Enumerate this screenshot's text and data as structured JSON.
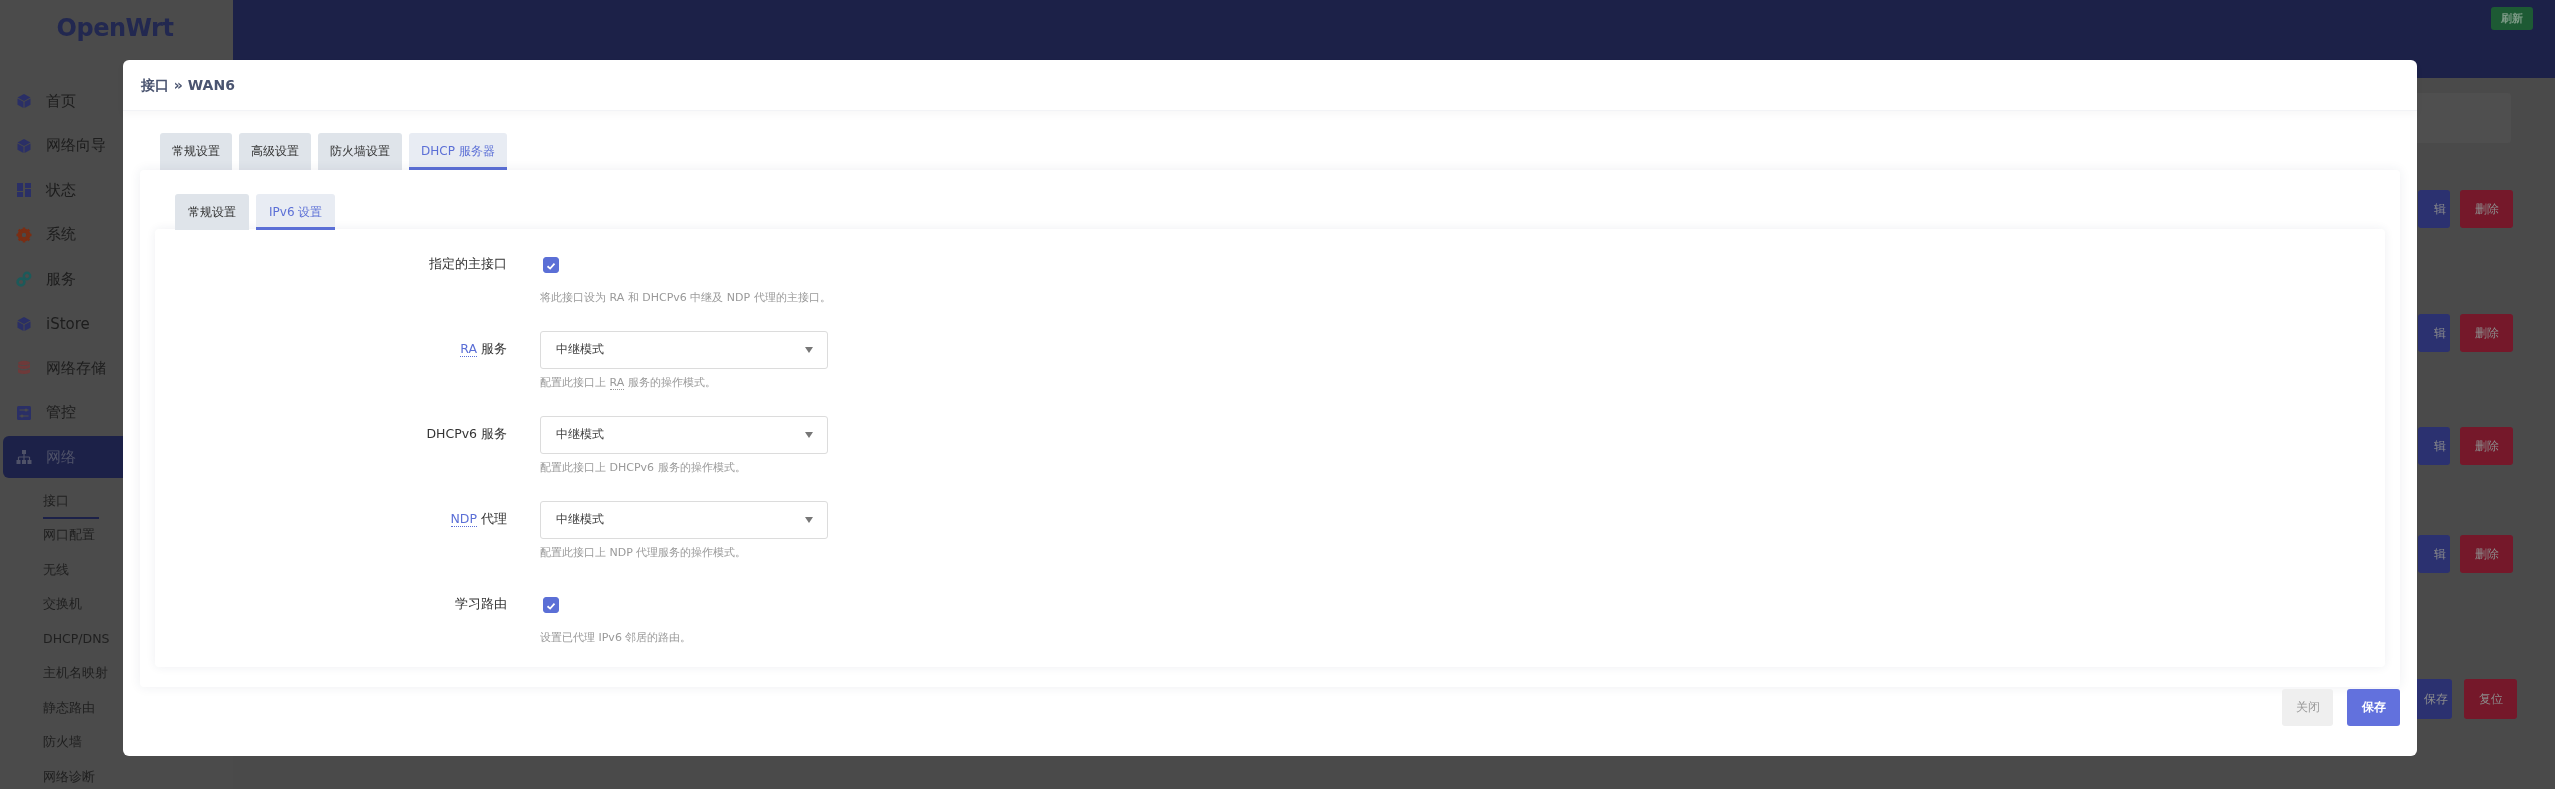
{
  "sidebar": {
    "logo": "OpenWrt",
    "items": [
      {
        "label": "首页",
        "selected": false
      },
      {
        "label": "网络向导",
        "selected": false
      },
      {
        "label": "状态",
        "selected": false
      },
      {
        "label": "系统",
        "selected": false
      },
      {
        "label": "服务",
        "selected": false
      },
      {
        "label": "iStore",
        "selected": false
      },
      {
        "label": "网络存储",
        "selected": false
      },
      {
        "label": "管控",
        "selected": false
      },
      {
        "label": "网络",
        "selected": true,
        "children": [
          {
            "label": "接口",
            "selected": true
          },
          {
            "label": "网口配置",
            "selected": false
          },
          {
            "label": "无线",
            "selected": false
          },
          {
            "label": "交换机",
            "selected": false
          },
          {
            "label": "DHCP/DNS",
            "selected": false
          },
          {
            "label": "主机名映射",
            "selected": false
          },
          {
            "label": "静态路由",
            "selected": false
          },
          {
            "label": "防火墙",
            "selected": false
          },
          {
            "label": "网络诊断",
            "selected": false
          }
        ]
      }
    ]
  },
  "header": {
    "refresh_button": "刷新"
  },
  "background_rows": [
    {
      "edit": "辑",
      "delete": "删除"
    },
    {
      "edit": "辑",
      "delete": "删除"
    },
    {
      "edit": "辑",
      "delete": "删除"
    },
    {
      "edit": "辑",
      "delete": "删除"
    }
  ],
  "background_footer": {
    "save": "保存",
    "reset": "复位"
  },
  "modal": {
    "title": "接口 » WAN6",
    "tabs": [
      {
        "label": "常规设置",
        "selected": false
      },
      {
        "label": "高级设置",
        "selected": false
      },
      {
        "label": "防火墙设置",
        "selected": false
      },
      {
        "label": "DHCP 服务器",
        "selected": true
      }
    ],
    "subtabs": [
      {
        "label": "常规设置",
        "selected": false
      },
      {
        "label": "IPv6 设置",
        "selected": true
      }
    ],
    "fields": [
      {
        "kind": "checkbox",
        "label": [
          {
            "text": "指定的主接口",
            "abbr": false
          }
        ],
        "checked": true,
        "help": [
          {
            "text": "将此接口设为 RA 和 DHCPv6 中继及 NDP 代理的主接口。",
            "abbr": false
          }
        ]
      },
      {
        "kind": "select",
        "label": [
          {
            "text": "RA",
            "abbr": true
          },
          {
            "text": " 服务",
            "abbr": false
          }
        ],
        "value": "中继模式",
        "help": [
          {
            "text": "配置此接口上 ",
            "abbr": false
          },
          {
            "text": "RA",
            "abbr": true
          },
          {
            "text": " 服务的操作模式。",
            "abbr": false
          }
        ]
      },
      {
        "kind": "select",
        "label": [
          {
            "text": "DHCPv6 服务",
            "abbr": false
          }
        ],
        "value": "中继模式",
        "help": [
          {
            "text": "配置此接口上 DHCPv6 服务的操作模式。",
            "abbr": false
          }
        ]
      },
      {
        "kind": "select",
        "label": [
          {
            "text": "NDP",
            "abbr": true
          },
          {
            "text": " 代理",
            "abbr": false
          }
        ],
        "value": "中继模式",
        "help": [
          {
            "text": "配置此接口上 NDP 代理服务的操作模式。",
            "abbr": false
          }
        ]
      },
      {
        "kind": "checkbox",
        "label": [
          {
            "text": "学习路由",
            "abbr": false
          }
        ],
        "checked": true,
        "help": [
          {
            "text": "设置已代理 IPv6 邻居的路由。",
            "abbr": false
          }
        ]
      }
    ],
    "buttons": {
      "close": "关闭",
      "save": "保存"
    }
  }
}
